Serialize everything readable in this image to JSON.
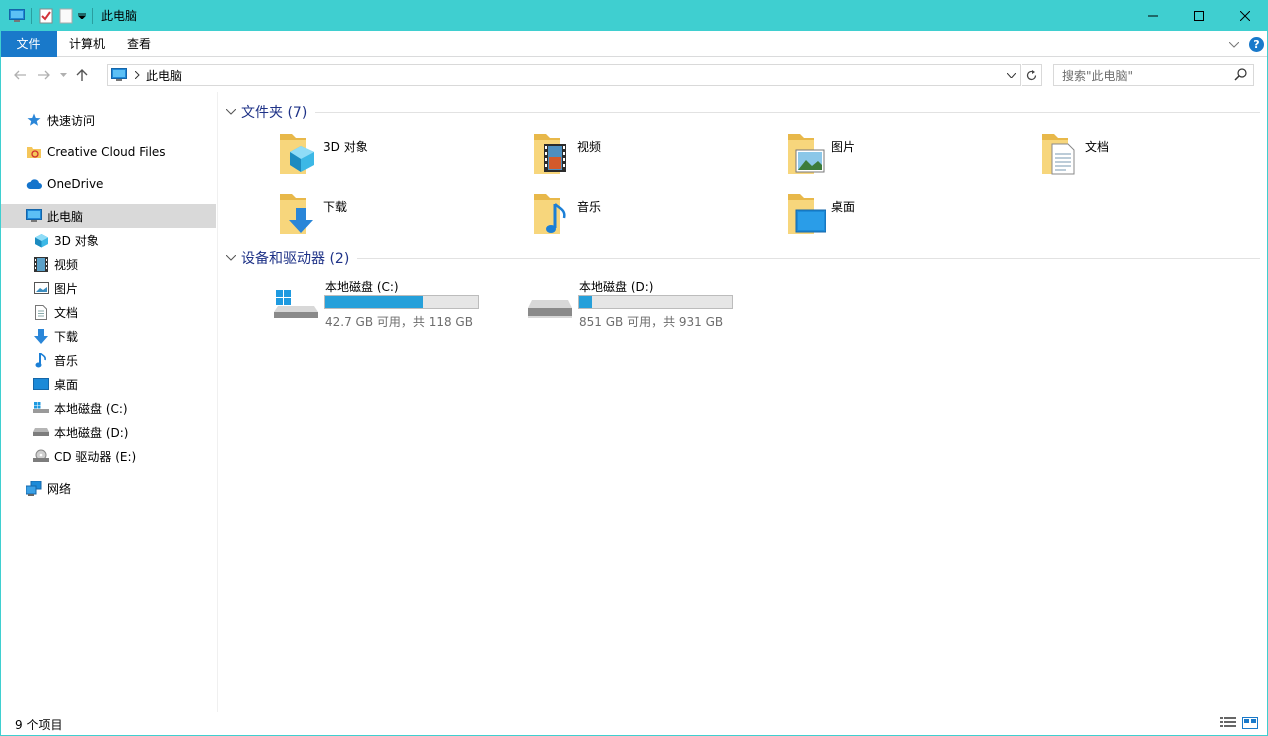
{
  "window": {
    "title": "此电脑",
    "accent": "#3fcfd0"
  },
  "ribbon": {
    "tabs": [
      "文件",
      "计算机",
      "查看"
    ],
    "help_label": "?"
  },
  "address": {
    "path": "此电脑",
    "search_placeholder": "搜索\"此电脑\""
  },
  "nav": {
    "quick_access": "快速访问",
    "creative_cloud": "Creative Cloud Files",
    "onedrive": "OneDrive",
    "this_pc": "此电脑",
    "sub": [
      "3D 对象",
      "视频",
      "图片",
      "文档",
      "下载",
      "音乐",
      "桌面",
      "本地磁盘 (C:)",
      "本地磁盘 (D:)",
      "CD 驱动器 (E:)"
    ],
    "network": "网络"
  },
  "folders_group": {
    "title": "文件夹 (7)",
    "items": [
      "3D 对象",
      "视频",
      "图片",
      "文档",
      "下载",
      "音乐",
      "桌面"
    ]
  },
  "drives_group": {
    "title": "设备和驱动器 (2)",
    "drives": [
      {
        "name": "本地磁盘 (C:)",
        "info": "42.7 GB 可用，共 118 GB",
        "used_fraction": 0.638
      },
      {
        "name": "本地磁盘 (D:)",
        "info": "851 GB 可用，共 931 GB",
        "used_fraction": 0.086
      }
    ]
  },
  "status": {
    "count": "9 个项目"
  }
}
